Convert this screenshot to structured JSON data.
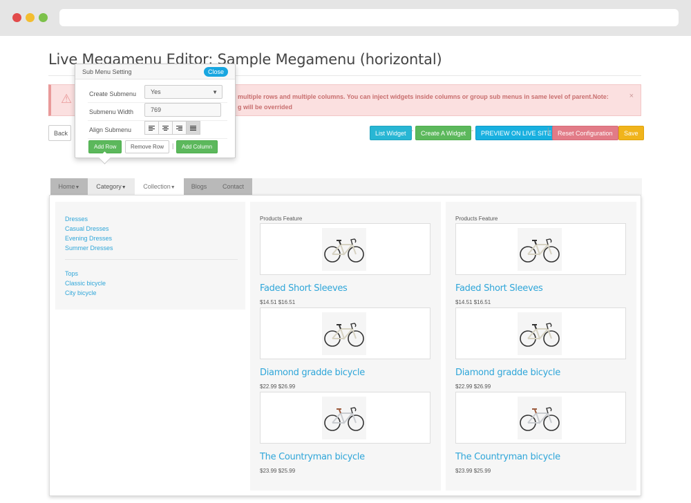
{
  "title": "Live Megamenu Editor: Sample Megamenu (horizontal)",
  "alert": {
    "text_line1": "multiple rows and multiple columns. You can inject widgets inside columns or group sub menus in same level of parent.Note:",
    "text_line2": "g will be overrided",
    "close": "×"
  },
  "toolbar": {
    "back": "Back",
    "list_widget": "List Widget",
    "create_widget": "Create A Widget",
    "preview": "PREVIEW ON LIVE SITE",
    "reset": "Reset Configuration",
    "save": "Save",
    "sep_dash": "-",
    "sep_pipe": "|"
  },
  "popover": {
    "title": "Sub Menu Setting",
    "close": "Close",
    "create_submenu_label": "Create Submenu",
    "create_submenu_value": "Yes",
    "submenu_width_label": "Submenu Width",
    "submenu_width_value": "769",
    "align_label": "Align Submenu",
    "add_row": "Add Row",
    "remove_row": "Remove Row",
    "add_column": "Add Column",
    "pipe": "|"
  },
  "nav": {
    "items": [
      "Home",
      "Category",
      "Collection",
      "Blogs",
      "Contact"
    ]
  },
  "links_group1": [
    "Dresses",
    "Casual Dresses",
    "Evening Dresses",
    "Summer Dresses"
  ],
  "links_group2": [
    "Tops",
    "Classic bicycle",
    "City bicycle"
  ],
  "feature_label": "Products Feature",
  "products": [
    {
      "name": "Faded Short Sleeves",
      "price": "$14.51 $16.51",
      "style": "road"
    },
    {
      "name": "Diamond gradde bicycle",
      "price": "$22.99 $26.99",
      "style": "road"
    },
    {
      "name": "The Countryman bicycle",
      "price": "$23.99 $25.99",
      "style": "city"
    }
  ],
  "colors": {
    "link": "#2fa6d9",
    "list_widget": "#28b6d4",
    "create_widget": "#5cb85c",
    "preview": "#18b0e0",
    "reset": "#e27b87",
    "save": "#f0b41c",
    "alert_bg": "#fbe0e0",
    "alert_text": "#c86f6f"
  }
}
